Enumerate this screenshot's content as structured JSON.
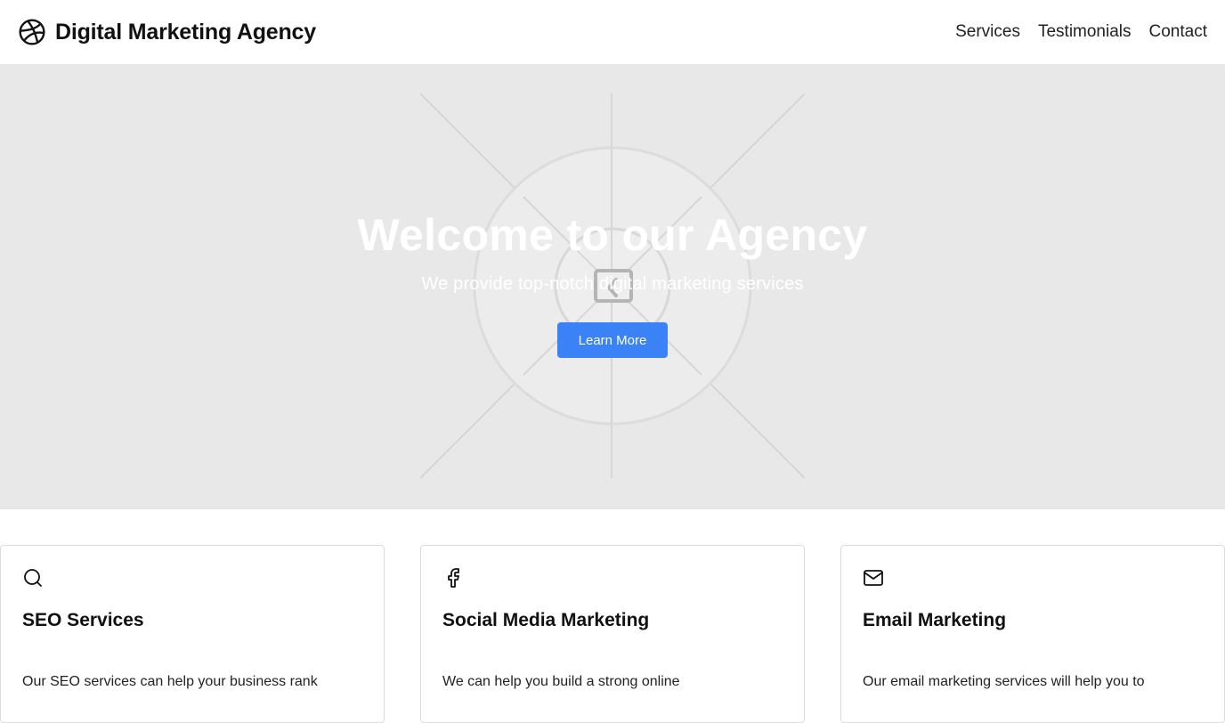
{
  "header": {
    "brand_name": "Digital Marketing Agency",
    "brand_icon": "dribbble-ball-icon",
    "nav": [
      {
        "label": "Services"
      },
      {
        "label": "Testimonials"
      },
      {
        "label": "Contact"
      }
    ]
  },
  "hero": {
    "title": "Welcome to our Agency",
    "subtitle": "We provide top-notch digital marketing services",
    "cta_label": "Learn More",
    "background_icon": "image-placeholder-icon"
  },
  "services": [
    {
      "icon": "search-icon",
      "title": "SEO Services",
      "text": "Our SEO services can help your business rank"
    },
    {
      "icon": "facebook-icon",
      "title": "Social Media Marketing",
      "text": "We can help you build a strong online"
    },
    {
      "icon": "mail-icon",
      "title": "Email Marketing",
      "text": "Our email marketing services will help you to"
    }
  ],
  "colors": {
    "accent": "#3b82f6",
    "hero_bg": "#e8e8e8",
    "card_border": "#dcdcdc"
  }
}
